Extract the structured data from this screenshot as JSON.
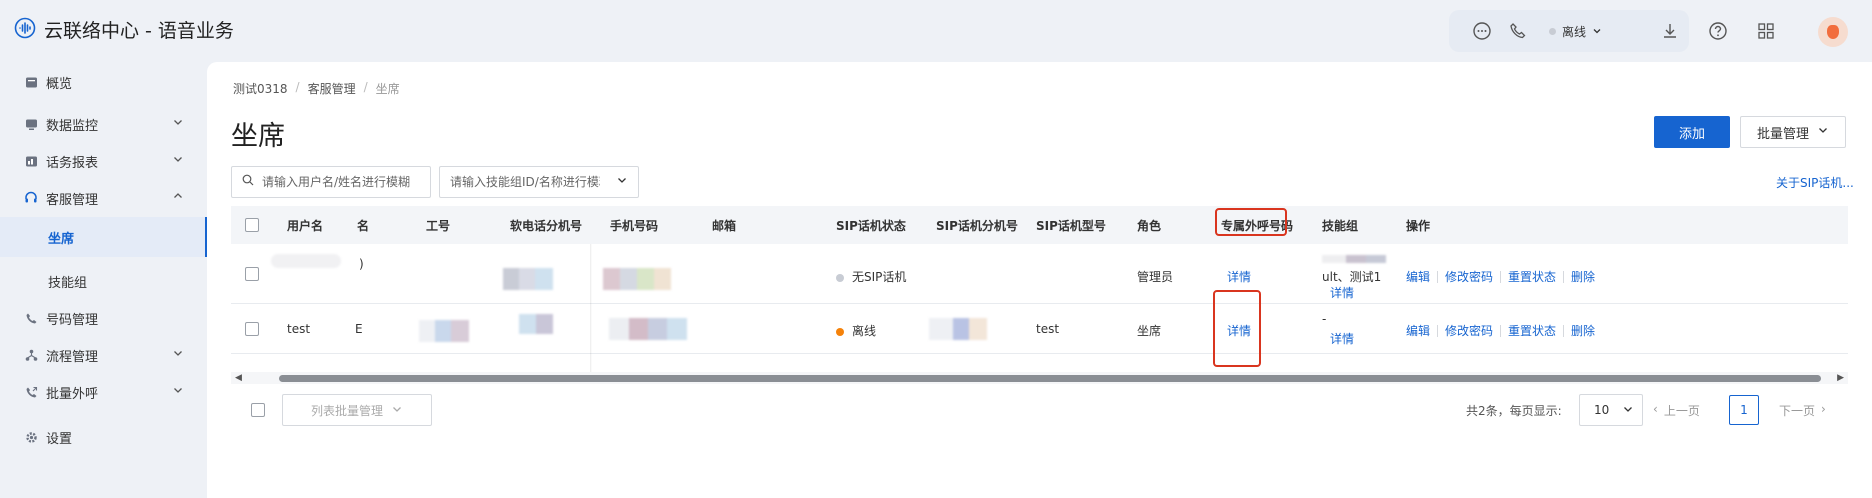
{
  "app": {
    "title": "云联络中心 - 语音业务"
  },
  "topbar": {
    "status": "离线"
  },
  "sidebar": {
    "items": [
      {
        "label": "概览",
        "icon": "overview-icon"
      },
      {
        "label": "数据监控",
        "icon": "monitor-icon"
      },
      {
        "label": "话务报表",
        "icon": "report-icon"
      },
      {
        "label": "客服管理",
        "icon": "headset-icon"
      },
      {
        "label": "坐席"
      },
      {
        "label": "技能组"
      },
      {
        "label": "号码管理",
        "icon": "phone-icon"
      },
      {
        "label": "流程管理",
        "icon": "flow-icon"
      },
      {
        "label": "批量外呼",
        "icon": "outbound-icon"
      },
      {
        "label": "设置",
        "icon": "gear-icon"
      }
    ]
  },
  "breadcrumb": {
    "a": "测试0318",
    "b": "客服管理",
    "c": "坐席"
  },
  "page": {
    "title": "坐席",
    "add_label": "添加",
    "batch_label": "批量管理",
    "search_user_placeholder": "请输入用户名/姓名进行模糊",
    "search_skill_placeholder": "请输入技能组ID/名称进行模糊",
    "sip_link": "关于SIP话机..."
  },
  "table": {
    "headers": {
      "username": "用户名",
      "name_tail": "名",
      "job_no": "工号",
      "ext": "软电话分机号",
      "mobile": "手机号码",
      "email": "邮箱",
      "sip_status": "SIP话机状态",
      "sip_ext": "SIP话机分机号",
      "sip_model": "SIP话机型号",
      "role": "角色",
      "dedicated": "专属外呼号码",
      "skill": "技能组",
      "ops": "操作"
    },
    "rows": [
      {
        "username": "",
        "name_tail": ")",
        "sip_status": "无SIP话机",
        "sip_model": "",
        "role": "管理员",
        "dedicated": "详情",
        "skill_text": "ult、测试1",
        "skill_link": "详情"
      },
      {
        "username": "test",
        "name_tail": "E",
        "sip_status": "离线",
        "sip_model": "test",
        "role": "坐席",
        "dedicated": "详情",
        "skill_text": "-",
        "skill_link": "详情"
      }
    ],
    "ops": {
      "edit": "编辑",
      "pwd": "修改密码",
      "reset": "重置状态",
      "del": "删除"
    }
  },
  "footer": {
    "list_batch": "列表批量管理",
    "total": "共2条，每页显示:",
    "page_size": "10",
    "prev": "上一页",
    "page": "1",
    "next": "下一页"
  },
  "colors": {
    "accent": "#1664d0",
    "highlight": "#d9351f",
    "offline": "#f5820a",
    "no_sip": "#c8ccd4"
  }
}
